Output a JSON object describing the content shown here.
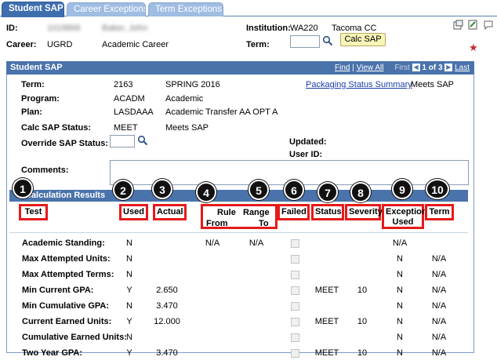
{
  "tabs": [
    {
      "label": "Student SAP",
      "active": true
    },
    {
      "label": "Career Exceptions",
      "active": false
    },
    {
      "label": "Term Exceptions",
      "active": false
    }
  ],
  "header": {
    "id_label": "ID:",
    "id_value": "1019866",
    "name_value": "Baker, John",
    "institution_label": "Institution:",
    "institution_code": "WA220",
    "institution_name": "Tacoma CC",
    "career_label": "Career:",
    "career_code": "UGRD",
    "career_desc": "Academic Career",
    "term_label": "Term:",
    "term_value": "",
    "calc_button": "Calc SAP"
  },
  "panel": {
    "title": "Student SAP",
    "find": "Find",
    "view_all": "View All",
    "first": "First",
    "range": "1 of 3",
    "last": "Last",
    "term_label": "Term:",
    "term_code": "2163",
    "term_desc": "SPRING 2016",
    "packaging_link": "Packaging Status Summary",
    "packaging_status": "Meets SAP",
    "program_label": "Program:",
    "program_code": "ACADM",
    "program_desc": "Academic",
    "plan_label": "Plan:",
    "plan_code": "LASDAAA",
    "plan_desc": "Academic Transfer AA OPT A",
    "calc_status_label": "Calc SAP Status:",
    "calc_status_code": "MEET",
    "calc_status_desc": "Meets SAP",
    "override_label": "Override SAP Status:",
    "updated_label": "Updated:",
    "userid_label": "User ID:",
    "comments_label": "Comments:"
  },
  "calc": {
    "title": "Calculation Results",
    "columns": {
      "test": "Test",
      "used": "Used",
      "actual": "Actual",
      "rule_from_1": "Rule",
      "rule_from_2": "From",
      "range_to_1": "Range",
      "range_to_2": "To",
      "failed": "Failed",
      "status": "Status",
      "severity": "Severity",
      "exception_1": "Exception",
      "exception_2": "Used",
      "term": "Term"
    },
    "markers": [
      "1",
      "2",
      "3",
      "4",
      "5",
      "6",
      "7",
      "8",
      "9",
      "10"
    ],
    "rows": [
      {
        "test": "Academic Standing:",
        "used": "N",
        "actual": "",
        "from": "N/A",
        "to": "N/A",
        "status": "",
        "severity": "",
        "exception": "N/A",
        "term": ""
      },
      {
        "test": "Max Attempted Units:",
        "used": "N",
        "actual": "",
        "from": "",
        "to": "",
        "status": "",
        "severity": "",
        "exception": "N",
        "term": "N/A"
      },
      {
        "test": "Max Attempted Terms:",
        "used": "N",
        "actual": "",
        "from": "",
        "to": "",
        "status": "",
        "severity": "",
        "exception": "N",
        "term": "N/A"
      },
      {
        "test": "Min Current GPA:",
        "used": "Y",
        "actual": "2.650",
        "from": "",
        "to": "",
        "status": "MEET",
        "severity": "10",
        "exception": "N",
        "term": "N/A"
      },
      {
        "test": "Min Cumulative GPA:",
        "used": "N",
        "actual": "3.470",
        "from": "",
        "to": "",
        "status": "",
        "severity": "",
        "exception": "N",
        "term": "N/A"
      },
      {
        "test": "Current Earned Units:",
        "used": "Y",
        "actual": "12.000",
        "from": "",
        "to": "",
        "status": "MEET",
        "severity": "10",
        "exception": "N",
        "term": "N/A"
      },
      {
        "test": "Cumulative Earned Units:",
        "used": "N",
        "actual": "",
        "from": "",
        "to": "",
        "status": "",
        "severity": "",
        "exception": "N",
        "term": "N/A"
      },
      {
        "test": "Two Year GPA:",
        "used": "Y",
        "actual": "3.470",
        "from": "",
        "to": "",
        "status": "MEET",
        "severity": "10",
        "exception": "N",
        "term": "N/A"
      }
    ]
  },
  "colors": {
    "tab_active": "#3e6eae",
    "tab_inactive": "#9fbde3",
    "panel_header": "#4a73ab",
    "highlight": "#e61a1a",
    "calc_button_bg": "#f8f5b8"
  },
  "icons": [
    "new-window-icon",
    "edit-icon",
    "help-icon",
    "required-star-icon",
    "lookup-icon"
  ]
}
